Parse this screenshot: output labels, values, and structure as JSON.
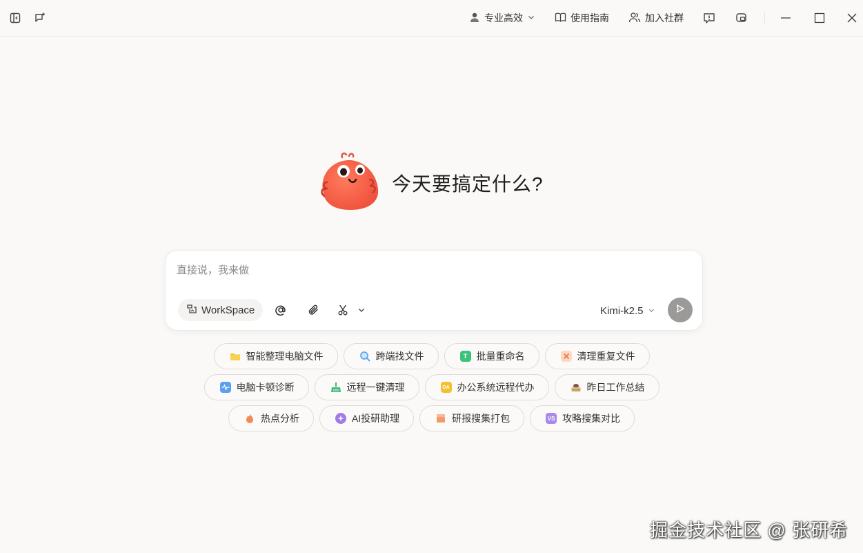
{
  "titlebar": {
    "mode_label": "专业高效",
    "guide_label": "使用指南",
    "community_label": "加入社群"
  },
  "hero": {
    "title": "今天要搞定什么?"
  },
  "input": {
    "placeholder": "直接说，我来做",
    "workspace_label": "WorkSpace",
    "model_label": "Kimi-k2.5"
  },
  "chips": {
    "row1": [
      {
        "label": "智能整理电脑文件",
        "icon": "folder-icon",
        "color": "#f5c431"
      },
      {
        "label": "跨端找文件",
        "icon": "search-file-icon",
        "color": "#5aa9f0"
      },
      {
        "label": "批量重命名",
        "icon": "rename-icon",
        "color": "#3cc27a"
      },
      {
        "label": "清理重复文件",
        "icon": "duplicate-clean-icon",
        "color": "#f39a6b"
      }
    ],
    "row2": [
      {
        "label": "电脑卡顿诊断",
        "icon": "diagnose-icon",
        "color": "#5b9ff2"
      },
      {
        "label": "远程一键清理",
        "icon": "remote-clean-icon",
        "color": "#3fb97b"
      },
      {
        "label": "办公系统远程代办",
        "icon": "oa-icon",
        "color": "#f4c032"
      },
      {
        "label": "昨日工作总结",
        "icon": "summary-icon",
        "color": "#c9a06a"
      }
    ],
    "row3": [
      {
        "label": "热点分析",
        "icon": "hot-icon",
        "color": "#f28a55"
      },
      {
        "label": "AI投研助理",
        "icon": "ai-research-icon",
        "color": "#a27ae8"
      },
      {
        "label": "研报搜集打包",
        "icon": "report-pack-icon",
        "color": "#f29a6a"
      },
      {
        "label": "攻略搜集对比",
        "icon": "compare-icon",
        "color": "#a98ae8"
      }
    ]
  },
  "watermark": "掘金技术社区 @ 张研希"
}
